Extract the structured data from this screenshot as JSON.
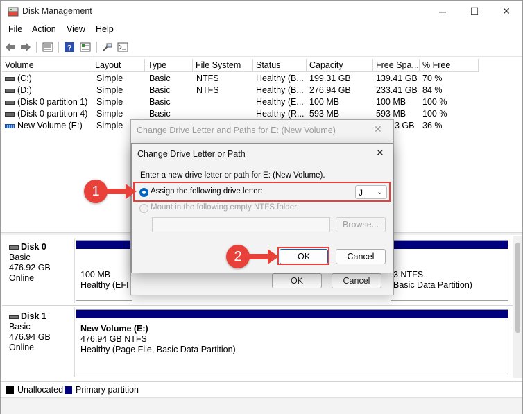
{
  "window": {
    "title": "Disk Management",
    "controls": {
      "minimize": "─",
      "maximize": "☐",
      "close": "✕"
    }
  },
  "menu": [
    "File",
    "Action",
    "View",
    "Help"
  ],
  "table": {
    "columns": [
      "Volume",
      "Layout",
      "Type",
      "File System",
      "Status",
      "Capacity",
      "Free Spa...",
      "% Free"
    ],
    "rows": [
      {
        "volume": "(C:)",
        "layout": "Simple",
        "type": "Basic",
        "fs": "NTFS",
        "status": "Healthy (B...",
        "capacity": "199.31 GB",
        "free": "139.41 GB",
        "pct": "70 %"
      },
      {
        "volume": "(D:)",
        "layout": "Simple",
        "type": "Basic",
        "fs": "NTFS",
        "status": "Healthy (B...",
        "capacity": "276.94 GB",
        "free": "233.41 GB",
        "pct": "84 %"
      },
      {
        "volume": "(Disk 0 partition 1)",
        "layout": "Simple",
        "type": "Basic",
        "fs": "",
        "status": "Healthy (E...",
        "capacity": "100 MB",
        "free": "100 MB",
        "pct": "100 %"
      },
      {
        "volume": "(Disk 0 partition 4)",
        "layout": "Simple",
        "type": "Basic",
        "fs": "",
        "status": "Healthy (R...",
        "capacity": "593 MB",
        "free": "593 MB",
        "pct": "100 %"
      },
      {
        "volume": "New Volume (E:)",
        "layout": "Simple",
        "type": "",
        "fs": "",
        "status": "",
        "capacity": "",
        "free": "3 GB",
        "pct": "36 %"
      }
    ]
  },
  "disks": [
    {
      "name": "Disk 0",
      "type": "Basic",
      "size": "476.92 GB",
      "state": "Online",
      "part1": {
        "size": "100 MB",
        "status": "Healthy (EFI"
      },
      "part3": {
        "size": "3 NTFS",
        "status": "Basic Data Partition)"
      }
    },
    {
      "name": "Disk 1",
      "type": "Basic",
      "size": "476.94 GB",
      "state": "Online",
      "part1": {
        "name": "New Volume  (E:)",
        "size": "476.94 GB NTFS",
        "status": "Healthy (Page File, Basic Data Partition)"
      }
    }
  ],
  "legend": {
    "unallocated": "Unallocated",
    "primary": "Primary partition"
  },
  "back_dialog": {
    "title": "Change Drive Letter and Paths for E: (New Volume)",
    "ok": "OK",
    "cancel": "Cancel",
    "close": "✕"
  },
  "front_dialog": {
    "title": "Change Drive Letter or Path",
    "close": "✕",
    "instruction": "Enter a new drive letter or path for E: (New Volume).",
    "option_assign": "Assign the following drive letter:",
    "option_mount": "Mount in the following empty NTFS folder:",
    "drive_letter": "J",
    "browse": "Browse...",
    "ok": "OK",
    "cancel": "Cancel"
  },
  "callouts": [
    "1",
    "2"
  ],
  "colors": {
    "highlight": "#e8413a",
    "primary_partition": "#00007f",
    "accent": "#0067c0"
  }
}
